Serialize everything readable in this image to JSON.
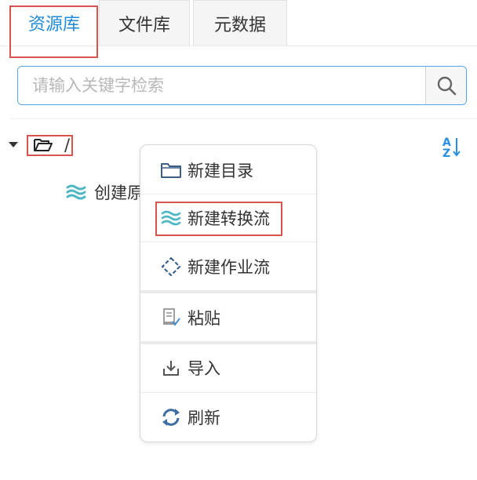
{
  "tabs": [
    {
      "label": "资源库",
      "active": true
    },
    {
      "label": "文件库",
      "active": false
    },
    {
      "label": "元数据",
      "active": false
    }
  ],
  "search": {
    "placeholder": "请输入关键字检索",
    "value": ""
  },
  "tree": {
    "root_label": "/",
    "child_label": "创建原"
  },
  "context_menu": {
    "items": [
      {
        "label": "新建目录",
        "icon": "folder-icon"
      },
      {
        "label": "新建转换流",
        "icon": "transform-flow-icon"
      },
      {
        "label": "新建作业流",
        "icon": "job-flow-icon"
      },
      {
        "label": "粘贴",
        "icon": "paste-icon"
      },
      {
        "label": "导入",
        "icon": "import-icon"
      },
      {
        "label": "刷新",
        "icon": "refresh-icon"
      }
    ]
  },
  "colors": {
    "accent": "#1e8ad8",
    "highlight_box": "#d9534f",
    "flow_icon": "#4fb7c4"
  }
}
